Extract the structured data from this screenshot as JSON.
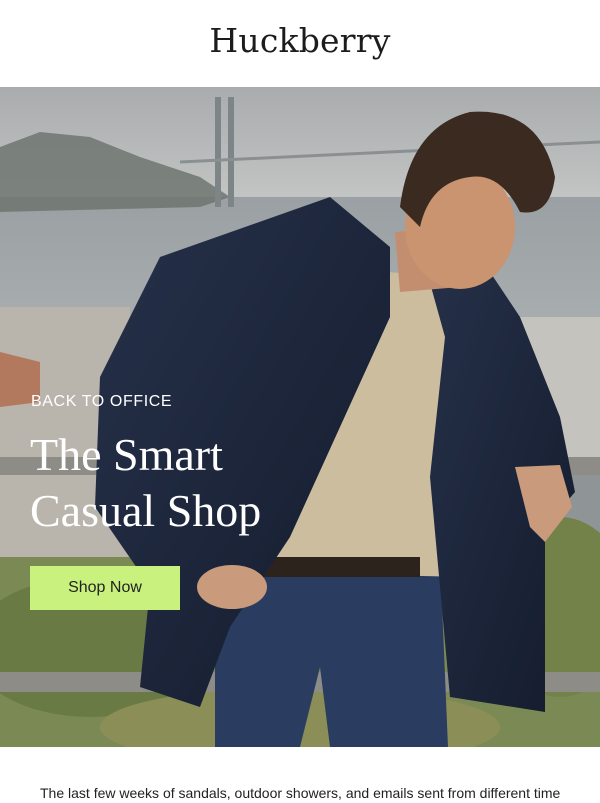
{
  "header": {
    "logo": "Huckberry"
  },
  "hero": {
    "kicker": "BACK TO OFFICE",
    "headline_line1": "The Smart",
    "headline_line2": "Casual Shop",
    "cta_label": "Shop Now",
    "cta_color": "#c8f27d"
  },
  "intro": {
    "text": "The last few weeks of sandals, outdoor showers, and emails sent from different time"
  }
}
